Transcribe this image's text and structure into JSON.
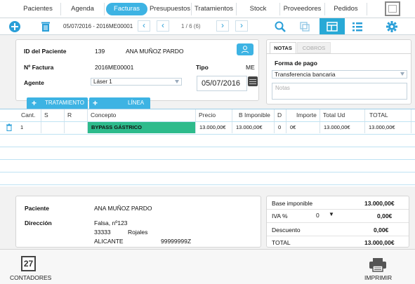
{
  "nav": {
    "tabs": [
      {
        "label": "Pacientes"
      },
      {
        "label": "Agenda"
      },
      {
        "label": "Facturas",
        "active": true
      },
      {
        "label": "Presupuestos"
      },
      {
        "label": "Tratamientos"
      },
      {
        "label": "Stock"
      },
      {
        "label": "Proveedores"
      },
      {
        "label": "Pedidos"
      }
    ]
  },
  "toolbar": {
    "range": "05/07/2016 - 2016ME00001",
    "pager": "1 / 6 (6)",
    "icons": [
      "plus-circle-icon",
      "trash-icon",
      "chevron-left-icon",
      "chevron-left-icon",
      "chevron-right-icon",
      "chevron-right-icon",
      "search-icon",
      "copy-icon",
      "layout-icon",
      "list-icon",
      "gear-icon"
    ]
  },
  "invoice": {
    "patient_id_label": "ID del Paciente",
    "patient_id": "139",
    "patient_name": "ANA MUÑOZ PARDO",
    "number_label": "Nº Factura",
    "number": "2016ME00001",
    "type_label": "Tipo",
    "type": "ME",
    "agent_label": "Agente",
    "agent": "Láser 1",
    "date": "05/07/2016"
  },
  "side": {
    "tab_notes": "NOTAS",
    "tab_charges": "COBROS",
    "payment_label": "Forma de pago",
    "payment": "Transferencia bancaria",
    "notes_placeholder": "Notas"
  },
  "actions": {
    "treatment": "TRATAMIENTO",
    "line": "LÍNEA"
  },
  "grid": {
    "columns": [
      "Cant.",
      "S",
      "R",
      "Concepto",
      "Precio",
      "B Imponible",
      "D",
      "Importe",
      "Total Ud",
      "TOTAL"
    ],
    "rows": [
      {
        "cant": "1",
        "s": "",
        "r": "",
        "concepto": "BYPASS GÁSTRICO",
        "precio": "13.000,00€",
        "base": "13.000,00€",
        "d": "0",
        "importe": "0€",
        "total_ud": "13.000,00€",
        "total": "13.000,00€"
      }
    ]
  },
  "patient_info": {
    "patient_label": "Paciente",
    "patient": "ANA MUÑOZ PARDO",
    "address_label": "Dirección",
    "street": "Falsa, nº123",
    "zip": "33333",
    "city": "Rojales",
    "province": "ALICANTE",
    "phone": "99999999Z"
  },
  "totals": {
    "base_label": "Base imponible",
    "base": "13.000,00€",
    "iva_label": "IVA %",
    "iva_rate": "0",
    "iva": "0,00€",
    "discount_label": "Descuento",
    "discount": "0,00€",
    "total_label": "TOTAL",
    "total": "13.000,00€"
  },
  "bottom": {
    "counters_label": "CONTADORES",
    "counters_icon_text": "27",
    "print_label": "IMPRIMIR"
  },
  "colors": {
    "accent": "#3db3e3",
    "dark_accent": "#28a9d6",
    "row_highlight": "#2dbb8c"
  }
}
